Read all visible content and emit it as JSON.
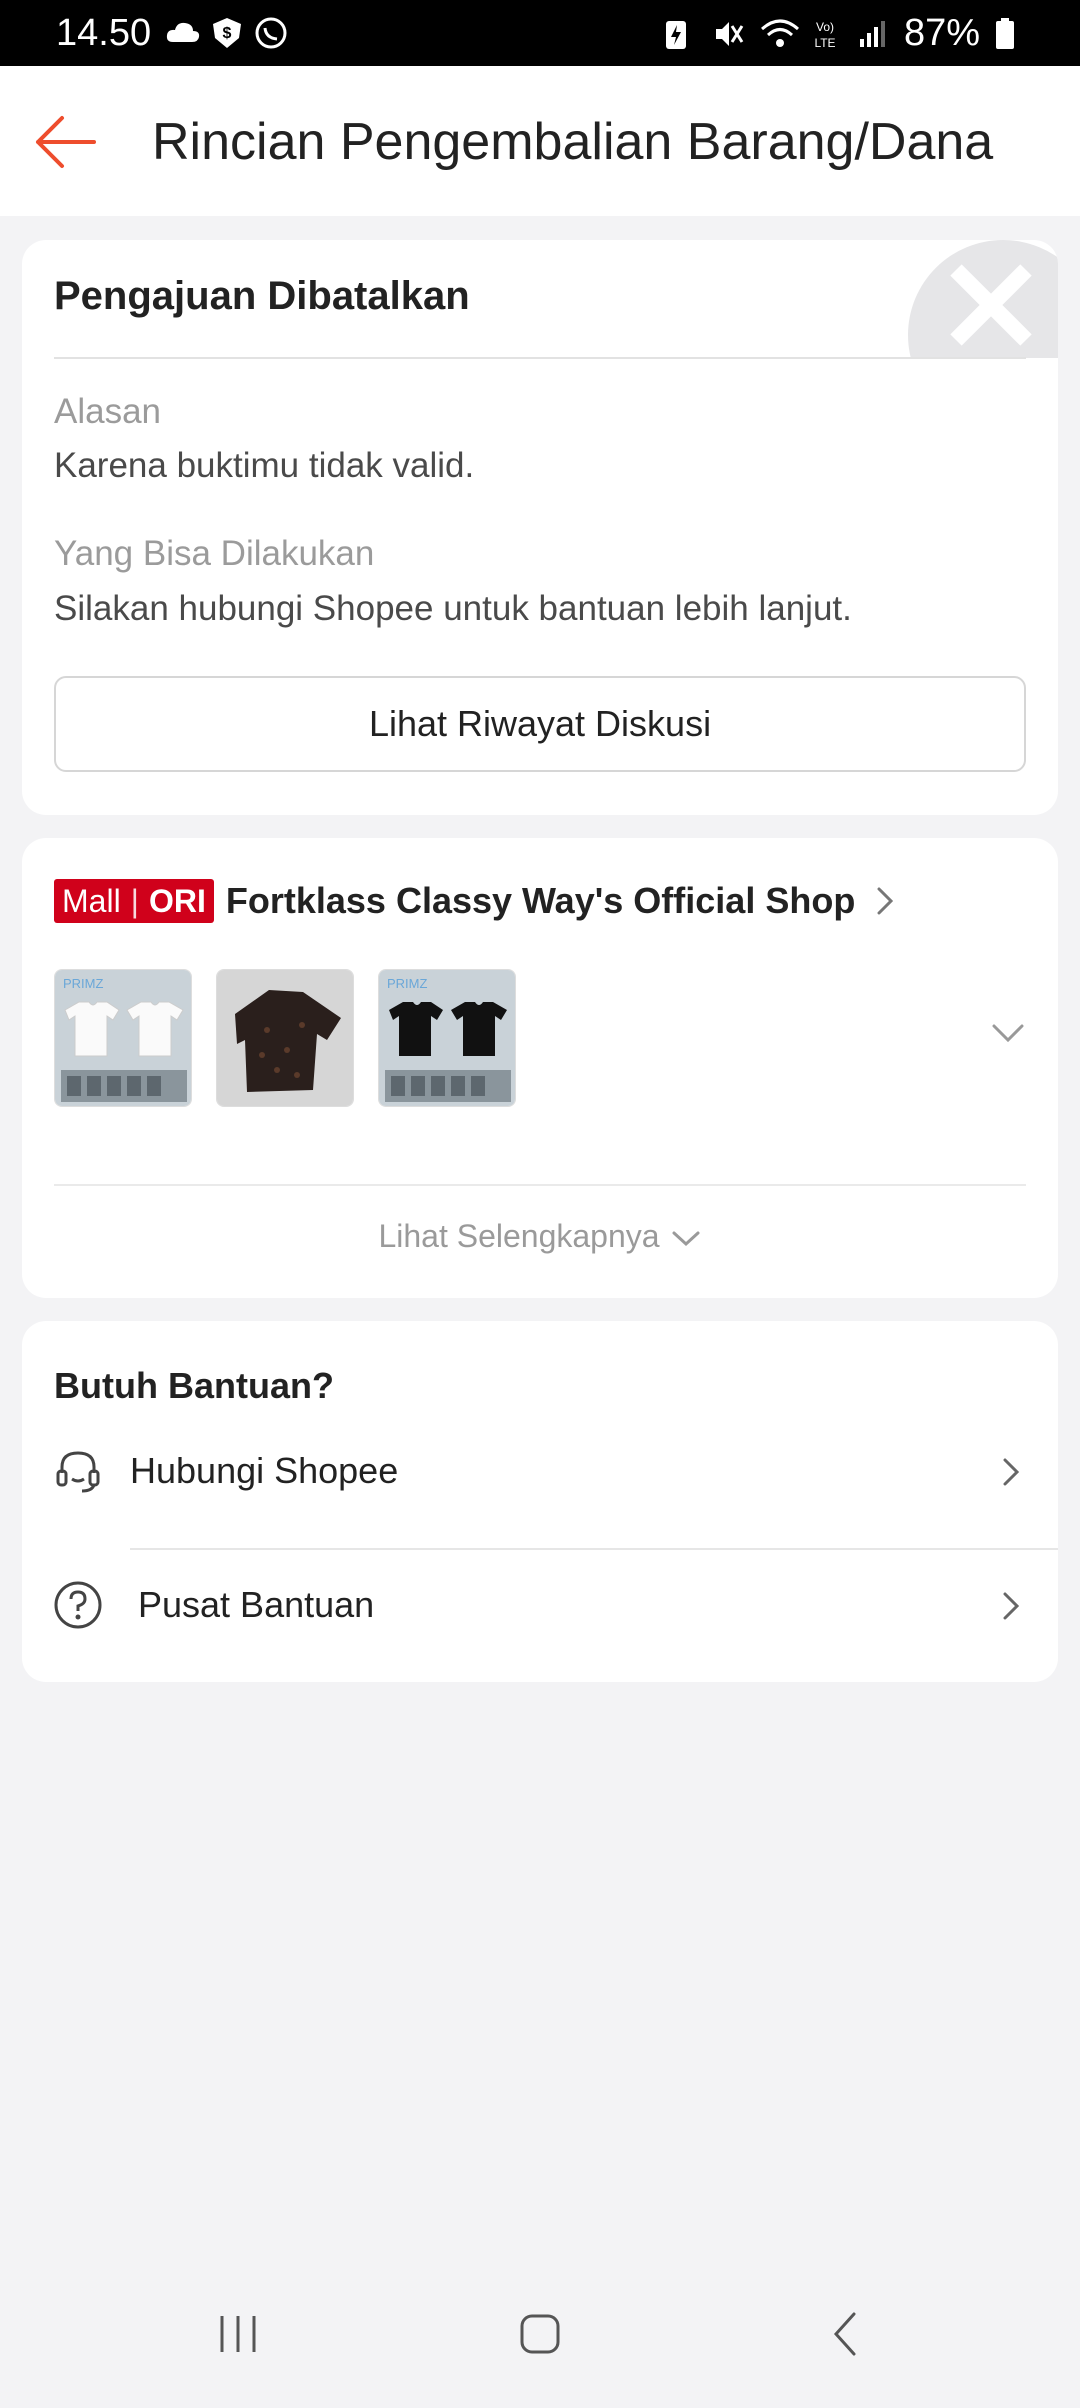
{
  "status_bar": {
    "time": "14.50",
    "battery": "87%"
  },
  "header": {
    "title": "Rincian Pengembalian Barang/Dana"
  },
  "status_card": {
    "title": "Pengajuan Dibatalkan",
    "reason_label": "Alasan",
    "reason_value": "Karena buktimu tidak valid.",
    "todo_label": "Yang Bisa Dilakukan",
    "todo_value": "Silakan hubungi Shopee untuk bantuan lebih lanjut.",
    "discussion_button": "Lihat Riwayat Diskusi"
  },
  "shop_card": {
    "badge_mall": "Mall",
    "badge_ori": "ORI",
    "shop_name": "Fortklass Classy Way's Official Shop",
    "see_more": "Lihat Selengkapnya",
    "products": [
      {
        "image": "white-tshirts-image"
      },
      {
        "image": "patterned-shirt-image"
      },
      {
        "image": "black-tshirts-image"
      }
    ]
  },
  "help_card": {
    "title": "Butuh Bantuan?",
    "items": [
      {
        "label": "Hubungi Shopee",
        "icon": "headset-icon"
      },
      {
        "label": "Pusat Bantuan",
        "icon": "question-circle-icon"
      }
    ]
  },
  "colors": {
    "accent": "#ee4d2d",
    "mall_red": "#d0011b",
    "background": "#f3f3f5"
  }
}
